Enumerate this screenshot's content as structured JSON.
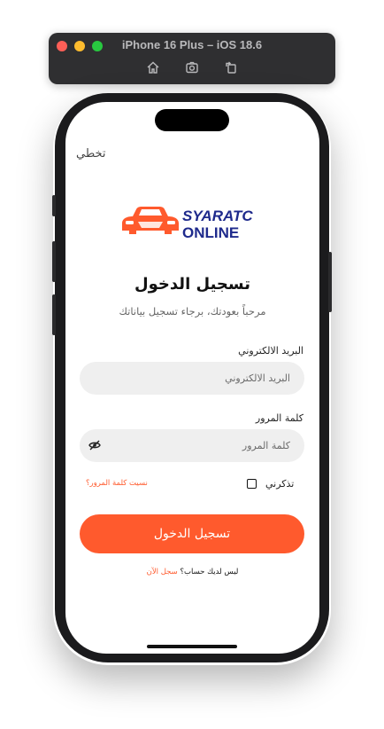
{
  "simulator": {
    "title": "iPhone 16 Plus – iOS 18.6",
    "tools": [
      "home-icon",
      "screenshot-icon",
      "rotate-icon"
    ]
  },
  "app": {
    "skip_label": "تخطي",
    "logo": {
      "line1": "SYARATC",
      "line2": "ONLINE",
      "brand_color": "#ff5a2d",
      "text_color": "#1e2a8c"
    },
    "title": "تسجيل الدخول",
    "subtitle": "مرحباً بعودتك، برجاء تسجيل بياناتك",
    "email": {
      "label": "البريد الالكتروني",
      "placeholder": "البريد الالكتروني",
      "value": ""
    },
    "password": {
      "label": "كلمة المرور",
      "placeholder": "كلمة المرور",
      "value": "",
      "toggle_icon": "eye-slash-icon"
    },
    "remember_label": "تذكرني",
    "remember_checked": false,
    "forgot_label": "نسيت كلمة المرور؟",
    "login_button": "تسجيل الدخول",
    "signup_prompt": "ليس لديك حساب؟",
    "signup_link": "سجل الآن",
    "accent_color": "#ff5a2d"
  }
}
